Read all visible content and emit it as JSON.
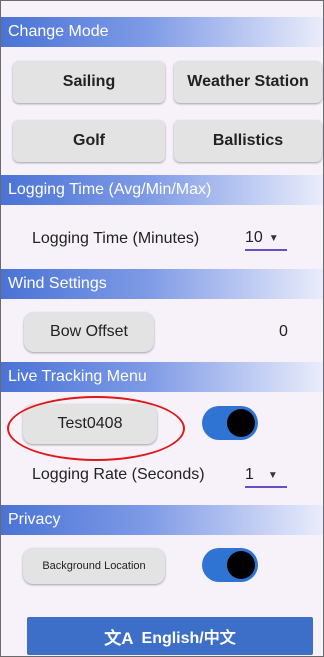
{
  "change_mode": {
    "header": "Change Mode",
    "buttons": [
      "Sailing",
      "Weather Station",
      "Golf",
      "Ballistics"
    ]
  },
  "logging_time": {
    "header": "Logging Time (Avg/Min/Max)",
    "label": "Logging Time (Minutes)",
    "value": "10"
  },
  "wind_settings": {
    "header": "Wind Settings",
    "bow_offset_label": "Bow Offset",
    "bow_offset_value": "0"
  },
  "live_tracking": {
    "header": "Live Tracking Menu",
    "tracker_name": "Test0408",
    "toggle_on": true,
    "logging_rate_label": "Logging Rate (Seconds)",
    "logging_rate_value": "1"
  },
  "privacy": {
    "header": "Privacy",
    "background_location_label": "Background Location",
    "toggle_on": true
  },
  "language_button": {
    "icon": "translate-icon",
    "label": "English/中文"
  },
  "colors": {
    "accent": "#3d6fc8",
    "toggle": "#2f73d3",
    "annotation": "#e01818"
  }
}
